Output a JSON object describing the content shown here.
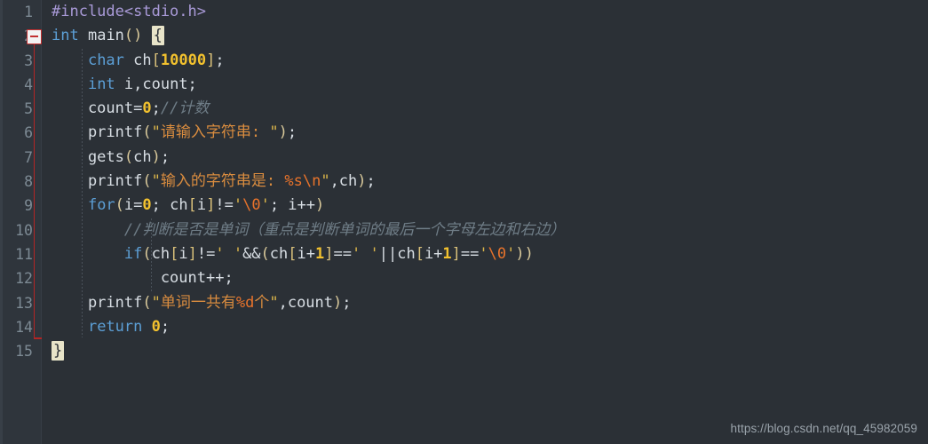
{
  "editor": {
    "language": "C",
    "background_color": "#2b3036",
    "gutter_color": "#2f353c",
    "fold_marker_color": "#c22f2f",
    "brace_match_color": "#e8e4c9",
    "line_numbers": [
      "1",
      "2",
      "3",
      "4",
      "5",
      "6",
      "7",
      "8",
      "9",
      "10",
      "11",
      "12",
      "13",
      "14",
      "15"
    ],
    "fold_marker": {
      "line": "2",
      "glyph": "−",
      "state": "expanded"
    }
  },
  "code": {
    "lines": [
      {
        "n": "1",
        "text": "#include<stdio.h>",
        "tokens": [
          {
            "c": "t-pre",
            "s": "#include<stdio.h>"
          }
        ]
      },
      {
        "n": "2",
        "text": "int main() {",
        "tokens": [
          {
            "c": "t-kw",
            "s": "int"
          },
          {
            "c": "t-plain",
            "s": " "
          },
          {
            "c": "t-plain",
            "s": "main"
          },
          {
            "c": "t-paren",
            "s": "()"
          },
          {
            "c": "t-plain",
            "s": " "
          },
          {
            "c": "brace-match",
            "s": "{"
          }
        ]
      },
      {
        "n": "3",
        "text": "    char ch[10000];",
        "tokens": [
          {
            "c": "t-plain",
            "s": "    "
          },
          {
            "c": "t-kw",
            "s": "char"
          },
          {
            "c": "t-plain",
            "s": " "
          },
          {
            "c": "t-plain",
            "s": "ch"
          },
          {
            "c": "t-brk",
            "s": "["
          },
          {
            "c": "t-num",
            "s": "10000"
          },
          {
            "c": "t-brk",
            "s": "]"
          },
          {
            "c": "t-plain",
            "s": ";"
          }
        ]
      },
      {
        "n": "4",
        "text": "    int i,count;",
        "tokens": [
          {
            "c": "t-plain",
            "s": "    "
          },
          {
            "c": "t-kw",
            "s": "int"
          },
          {
            "c": "t-plain",
            "s": " i,count;"
          }
        ]
      },
      {
        "n": "5",
        "text": "    count=0;//计数",
        "tokens": [
          {
            "c": "t-plain",
            "s": "    count="
          },
          {
            "c": "t-num",
            "s": "0"
          },
          {
            "c": "t-plain",
            "s": ";"
          },
          {
            "c": "t-comment",
            "s": "//计数"
          }
        ]
      },
      {
        "n": "6",
        "text": "    printf(\"请输入字符串: \");",
        "tokens": [
          {
            "c": "t-plain",
            "s": "    printf"
          },
          {
            "c": "t-paren",
            "s": "("
          },
          {
            "c": "t-quote",
            "s": "\""
          },
          {
            "c": "t-str",
            "s": "请输入字符串: "
          },
          {
            "c": "t-quote",
            "s": "\""
          },
          {
            "c": "t-paren",
            "s": ")"
          },
          {
            "c": "t-plain",
            "s": ";"
          }
        ]
      },
      {
        "n": "7",
        "text": "    gets(ch);",
        "tokens": [
          {
            "c": "t-plain",
            "s": "    gets"
          },
          {
            "c": "t-paren",
            "s": "("
          },
          {
            "c": "t-plain",
            "s": "ch"
          },
          {
            "c": "t-paren",
            "s": ")"
          },
          {
            "c": "t-plain",
            "s": ";"
          }
        ]
      },
      {
        "n": "8",
        "text": "    printf(\"输入的字符串是: %s\\n\",ch);",
        "tokens": [
          {
            "c": "t-plain",
            "s": "    printf"
          },
          {
            "c": "t-paren",
            "s": "("
          },
          {
            "c": "t-quote",
            "s": "\""
          },
          {
            "c": "t-str",
            "s": "输入的字符串是: "
          },
          {
            "c": "t-esc",
            "s": "%s"
          },
          {
            "c": "t-esc",
            "s": "\\n"
          },
          {
            "c": "t-quote",
            "s": "\""
          },
          {
            "c": "t-plain",
            "s": ",ch"
          },
          {
            "c": "t-paren",
            "s": ")"
          },
          {
            "c": "t-plain",
            "s": ";"
          }
        ]
      },
      {
        "n": "9",
        "text": "    for(i=0; ch[i]!='\\0'; i++)",
        "tokens": [
          {
            "c": "t-plain",
            "s": "    "
          },
          {
            "c": "t-kw",
            "s": "for"
          },
          {
            "c": "t-paren",
            "s": "("
          },
          {
            "c": "t-plain",
            "s": "i="
          },
          {
            "c": "t-num",
            "s": "0"
          },
          {
            "c": "t-plain",
            "s": "; ch"
          },
          {
            "c": "t-brk",
            "s": "["
          },
          {
            "c": "t-plain",
            "s": "i"
          },
          {
            "c": "t-brk",
            "s": "]"
          },
          {
            "c": "t-plain",
            "s": "!="
          },
          {
            "c": "t-quote",
            "s": "'"
          },
          {
            "c": "t-esc",
            "s": "\\0"
          },
          {
            "c": "t-quote",
            "s": "'"
          },
          {
            "c": "t-plain",
            "s": "; i++"
          },
          {
            "c": "t-paren",
            "s": ")"
          }
        ]
      },
      {
        "n": "10",
        "text": "        //判断是否是单词（重点是判断单词的最后一个字母左边和右边）",
        "tokens": [
          {
            "c": "t-plain",
            "s": "        "
          },
          {
            "c": "t-comment",
            "s": "//判断是否是单词（重点是判断单词的最后一个字母左边和右边）"
          }
        ]
      },
      {
        "n": "11",
        "text": "        if(ch[i]!=' '&&(ch[i+1]==' '||ch[i+1]=='\\0'))",
        "tokens": [
          {
            "c": "t-plain",
            "s": "        "
          },
          {
            "c": "t-kw",
            "s": "if"
          },
          {
            "c": "t-paren",
            "s": "("
          },
          {
            "c": "t-plain",
            "s": "ch"
          },
          {
            "c": "t-brk",
            "s": "["
          },
          {
            "c": "t-plain",
            "s": "i"
          },
          {
            "c": "t-brk",
            "s": "]"
          },
          {
            "c": "t-plain",
            "s": "!="
          },
          {
            "c": "t-quote",
            "s": "' '"
          },
          {
            "c": "t-plain",
            "s": "&&"
          },
          {
            "c": "t-paren",
            "s": "("
          },
          {
            "c": "t-plain",
            "s": "ch"
          },
          {
            "c": "t-brk",
            "s": "["
          },
          {
            "c": "t-plain",
            "s": "i+"
          },
          {
            "c": "t-num",
            "s": "1"
          },
          {
            "c": "t-brk",
            "s": "]"
          },
          {
            "c": "t-plain",
            "s": "=="
          },
          {
            "c": "t-quote",
            "s": "' '"
          },
          {
            "c": "t-plain",
            "s": "||"
          },
          {
            "c": "t-plain",
            "s": "ch"
          },
          {
            "c": "t-brk",
            "s": "["
          },
          {
            "c": "t-plain",
            "s": "i+"
          },
          {
            "c": "t-num",
            "s": "1"
          },
          {
            "c": "t-brk",
            "s": "]"
          },
          {
            "c": "t-plain",
            "s": "=="
          },
          {
            "c": "t-quote",
            "s": "'"
          },
          {
            "c": "t-esc",
            "s": "\\0"
          },
          {
            "c": "t-quote",
            "s": "'"
          },
          {
            "c": "t-paren",
            "s": "))"
          }
        ]
      },
      {
        "n": "12",
        "text": "            count++;",
        "tokens": [
          {
            "c": "t-plain",
            "s": "            count++;"
          }
        ]
      },
      {
        "n": "13",
        "text": "    printf(\"单词一共有%d个\",count);",
        "tokens": [
          {
            "c": "t-plain",
            "s": "    printf"
          },
          {
            "c": "t-paren",
            "s": "("
          },
          {
            "c": "t-quote",
            "s": "\""
          },
          {
            "c": "t-str",
            "s": "单词一共有"
          },
          {
            "c": "t-esc",
            "s": "%d"
          },
          {
            "c": "t-str",
            "s": "个"
          },
          {
            "c": "t-quote",
            "s": "\""
          },
          {
            "c": "t-plain",
            "s": ",count"
          },
          {
            "c": "t-paren",
            "s": ")"
          },
          {
            "c": "t-plain",
            "s": ";"
          }
        ]
      },
      {
        "n": "14",
        "text": "    return 0;",
        "tokens": [
          {
            "c": "t-plain",
            "s": "    "
          },
          {
            "c": "t-kw",
            "s": "return"
          },
          {
            "c": "t-plain",
            "s": " "
          },
          {
            "c": "t-num",
            "s": "0"
          },
          {
            "c": "t-plain",
            "s": ";"
          }
        ]
      },
      {
        "n": "15",
        "text": "}",
        "tokens": [
          {
            "c": "brace-match",
            "s": "}"
          }
        ]
      }
    ]
  },
  "watermark": {
    "text": "https://blog.csdn.net/qq_45982059"
  }
}
